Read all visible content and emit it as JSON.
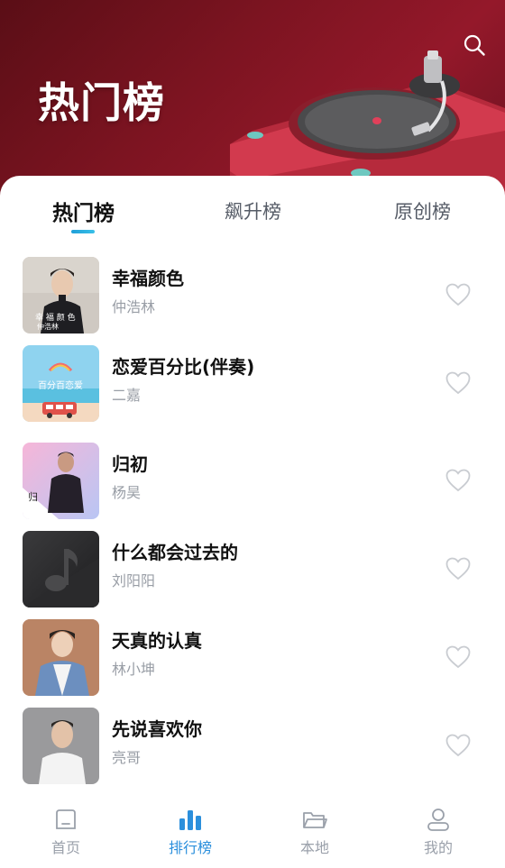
{
  "header": {
    "title": "热门榜",
    "search_icon": "search-icon"
  },
  "tabs": [
    {
      "label": "热门榜",
      "active": true
    },
    {
      "label": "飙升榜",
      "active": false
    },
    {
      "label": "原创榜",
      "active": false
    }
  ],
  "songs": [
    {
      "title": "幸福颜色",
      "artist": "仲浩林",
      "cover_text": "仲浩林"
    },
    {
      "title": "恋爱百分比(伴奏)",
      "artist": "二嘉"
    },
    {
      "title": "归初",
      "artist": "杨昊"
    },
    {
      "title": "什么都会过去的",
      "artist": "刘阳阳"
    },
    {
      "title": "天真的认真",
      "artist": "林小坤"
    },
    {
      "title": "先说喜欢你",
      "artist": "亮哥"
    }
  ],
  "bottom_nav": [
    {
      "label": "首页",
      "icon": "home-icon",
      "active": false
    },
    {
      "label": "排行榜",
      "icon": "chart-icon",
      "active": true
    },
    {
      "label": "本地",
      "icon": "folder-icon",
      "active": false
    },
    {
      "label": "我的",
      "icon": "user-icon",
      "active": false
    }
  ],
  "colors": {
    "accent": "#2b8fdc",
    "hero_bg": "#7d1421",
    "text_primary": "#111111",
    "text_secondary": "#999ea6"
  }
}
